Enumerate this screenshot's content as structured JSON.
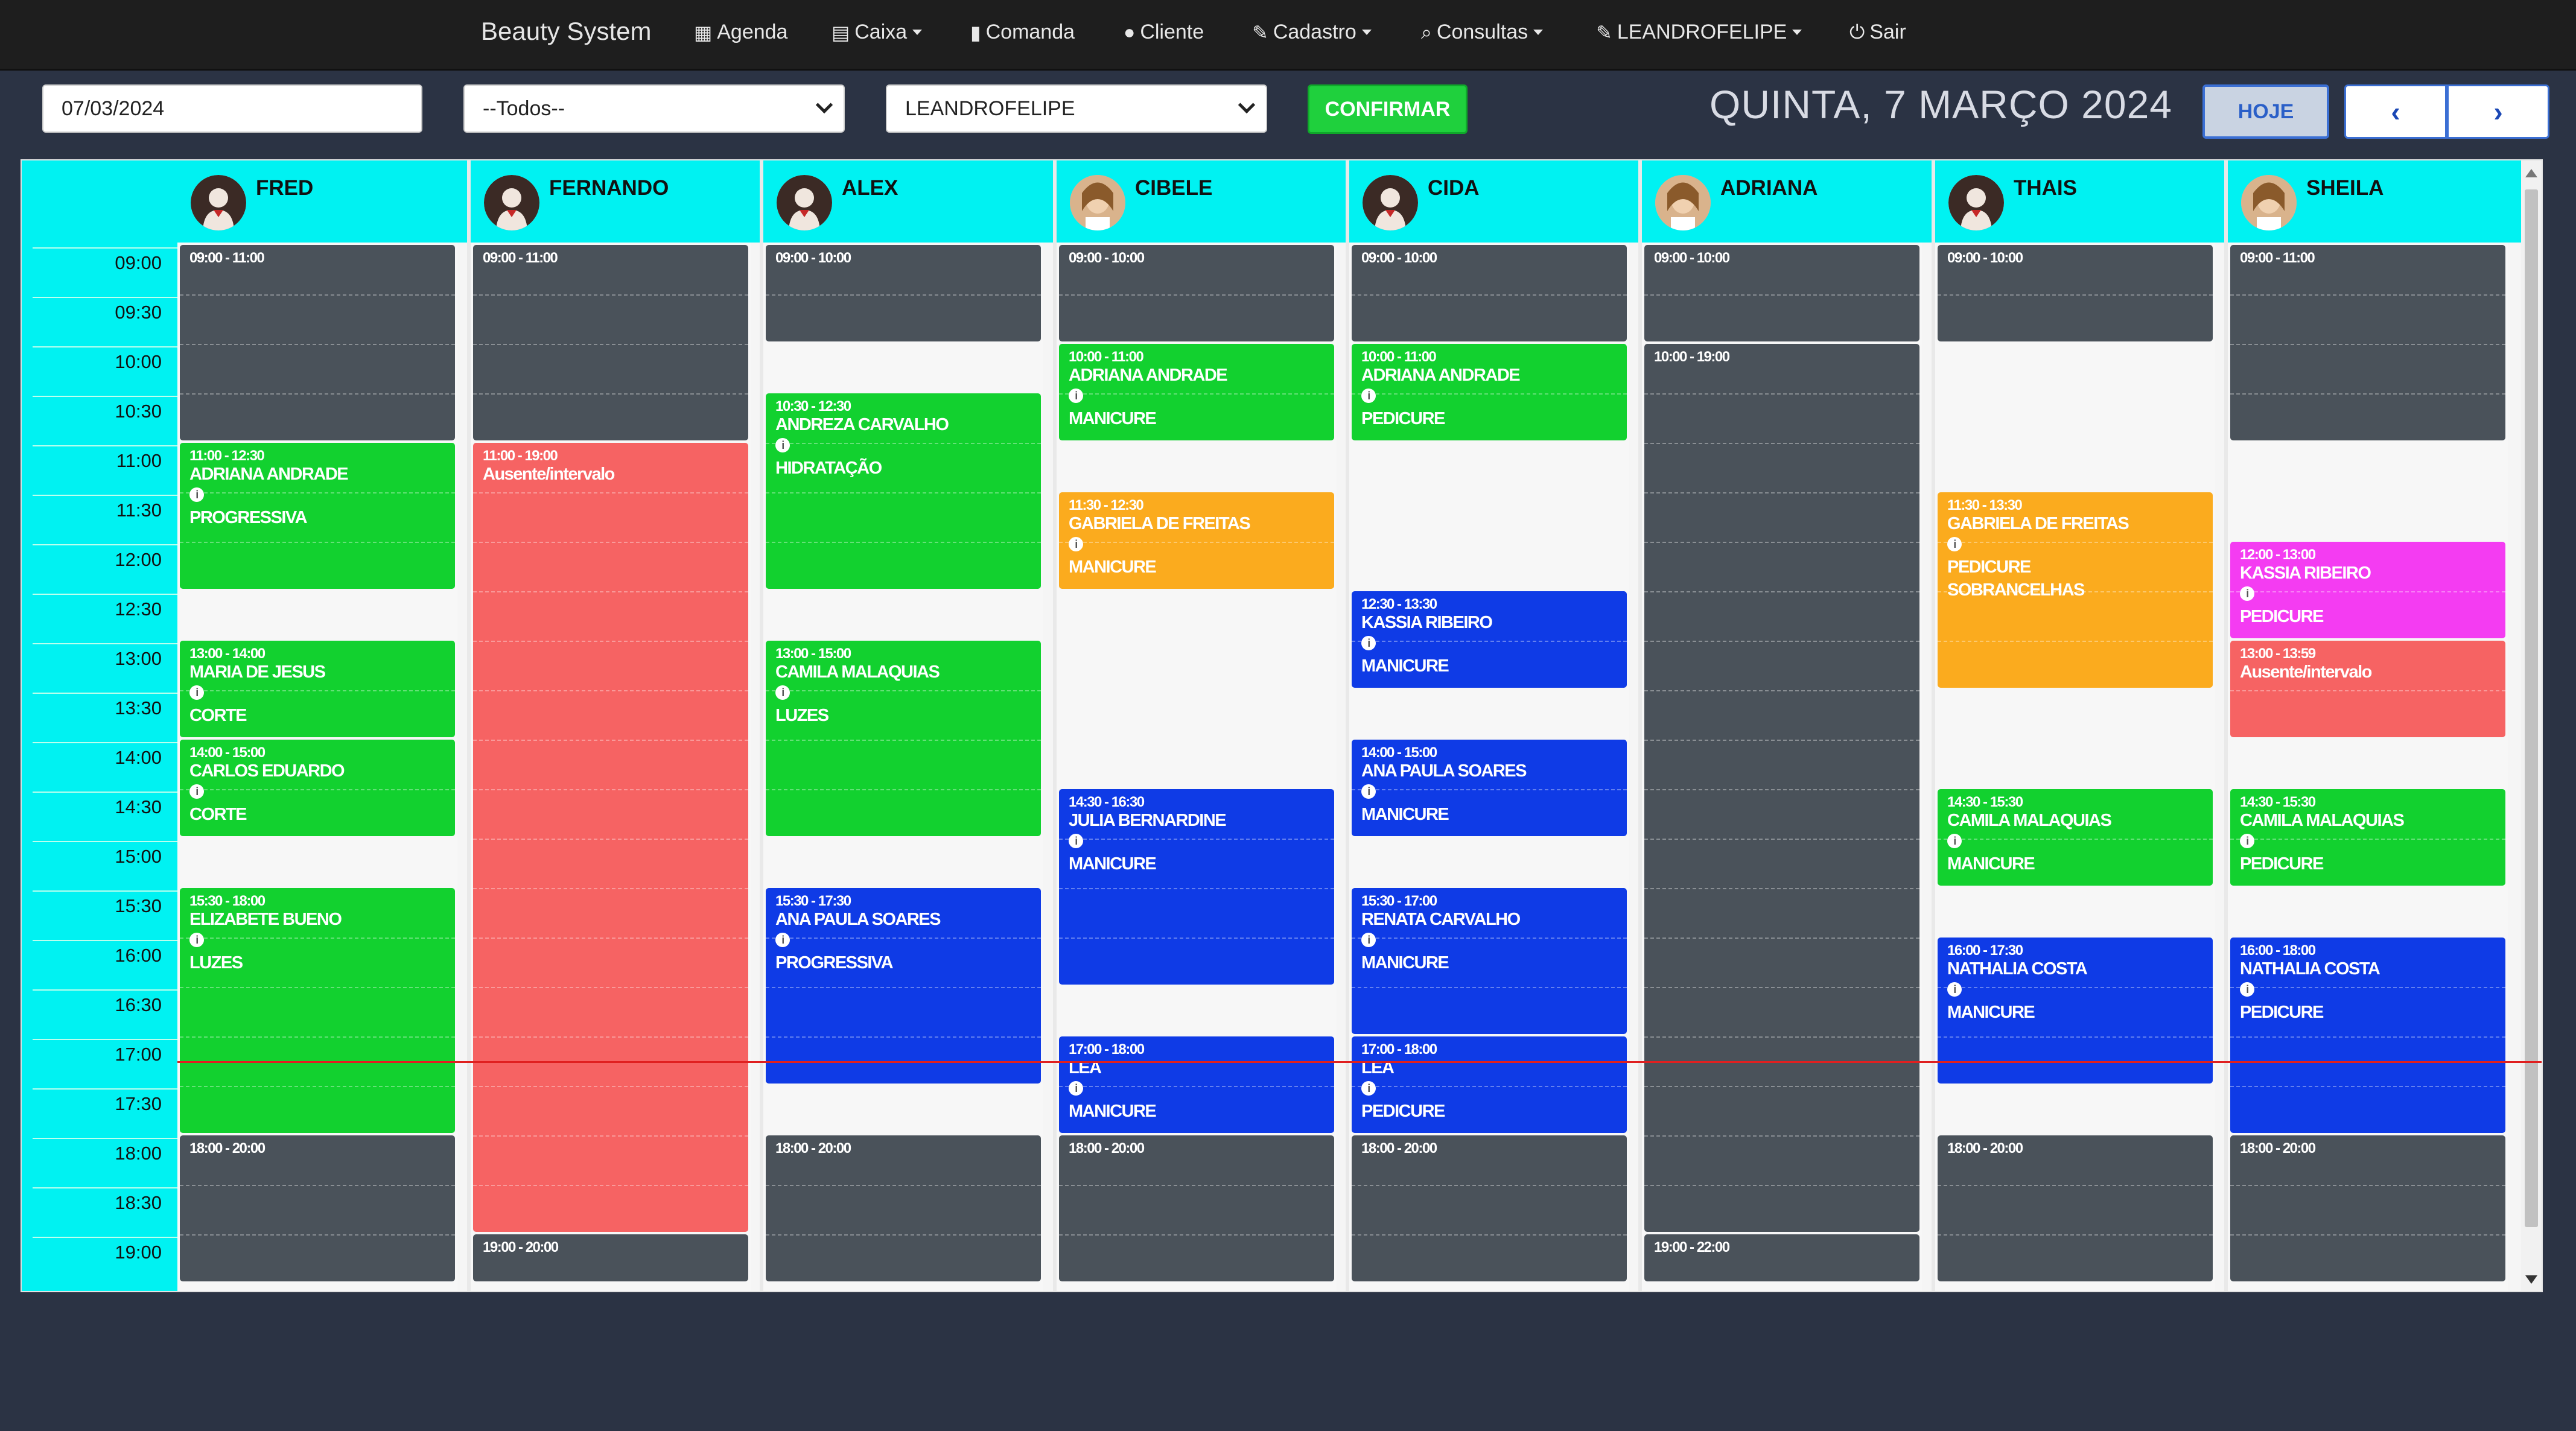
{
  "nav": {
    "brand": "Beauty System",
    "items": [
      {
        "label": "Agenda",
        "icon": "calendar-icon",
        "caret": false
      },
      {
        "label": "Caixa",
        "icon": "cash-register-icon",
        "caret": true
      },
      {
        "label": "Comanda",
        "icon": "document-icon",
        "caret": false
      },
      {
        "label": "Cliente",
        "icon": "user-icon",
        "caret": false
      },
      {
        "label": "Cadastro",
        "icon": "pencil-icon",
        "caret": true
      },
      {
        "label": "Consultas",
        "icon": "search-icon",
        "caret": true
      },
      {
        "label": "LEANDROFELIPE",
        "icon": "wrench-icon",
        "caret": true
      },
      {
        "label": "Sair",
        "icon": "power-icon",
        "caret": false
      }
    ]
  },
  "toolbar": {
    "date_value": "07/03/2024",
    "filter_selected": "--Todos--",
    "user_selected": "LEANDROFELIPE",
    "confirm_label": "CONFIRMAR",
    "date_title": "QUINTA, 7 MARÇO 2024",
    "today_label": "HOJE",
    "prev_label": "‹",
    "next_label": "›"
  },
  "calendar": {
    "times": [
      "09:00",
      "09:30",
      "10:00",
      "10:30",
      "11:00",
      "11:30",
      "12:00",
      "12:30",
      "13:00",
      "13:30",
      "14:00",
      "14:30",
      "15:00",
      "15:30",
      "16:00",
      "16:30",
      "17:00",
      "17:30",
      "18:00",
      "18:30",
      "19:00"
    ],
    "professionals": [
      {
        "name": "FRED",
        "avatar": "avatar-placeholder-icon"
      },
      {
        "name": "FERNANDO",
        "avatar": "avatar-placeholder-icon"
      },
      {
        "name": "ALEX",
        "avatar": "avatar-placeholder-icon"
      },
      {
        "name": "CIBELE",
        "avatar": "avatar-photo"
      },
      {
        "name": "CIDA",
        "avatar": "avatar-placeholder-icon"
      },
      {
        "name": "ADRIANA",
        "avatar": "avatar-photo"
      },
      {
        "name": "THAIS",
        "avatar": "avatar-placeholder-icon"
      },
      {
        "name": "SHEILA",
        "avatar": "avatar-photo"
      }
    ],
    "appointments": [
      {
        "col": 0,
        "start": "09:00",
        "end": "11:00",
        "time": "09:00 - 11:00",
        "client": "",
        "service": "",
        "status": "unavailable",
        "color": "#4a525a"
      },
      {
        "col": 0,
        "start": "11:00",
        "end": "12:30",
        "time": "11:00 - 12:30",
        "client": "ADRIANA ANDRADE",
        "service": "PROGRESSIVA",
        "status": "booked",
        "color": "#12d12f"
      },
      {
        "col": 0,
        "start": "13:00",
        "end": "14:00",
        "time": "13:00 - 14:00",
        "client": "MARIA DE JESUS",
        "service": "CORTE",
        "status": "booked",
        "color": "#12d12f"
      },
      {
        "col": 0,
        "start": "14:00",
        "end": "15:00",
        "time": "14:00 - 15:00",
        "client": "CARLOS EDUARDO",
        "service": "CORTE",
        "status": "booked",
        "color": "#12d12f"
      },
      {
        "col": 0,
        "start": "15:30",
        "end": "18:00",
        "time": "15:30 - 18:00",
        "client": "ELIZABETE BUENO",
        "service": "LUZES",
        "status": "booked",
        "color": "#12d12f"
      },
      {
        "col": 0,
        "start": "18:00",
        "end": "20:00",
        "time": "18:00 - 20:00",
        "client": "",
        "service": "",
        "status": "unavailable",
        "color": "#4a525a"
      },
      {
        "col": 1,
        "start": "09:00",
        "end": "11:00",
        "time": "09:00 - 11:00",
        "client": "",
        "service": "",
        "status": "unavailable",
        "color": "#4a525a"
      },
      {
        "col": 1,
        "start": "11:00",
        "end": "19:00",
        "time": "11:00 - 19:00",
        "client": "Ausente/intervalo",
        "service": "",
        "status": "absent",
        "color": "#f66363"
      },
      {
        "col": 1,
        "start": "19:00",
        "end": "20:00",
        "time": "19:00 - 20:00",
        "client": "",
        "service": "",
        "status": "unavailable",
        "color": "#4a525a"
      },
      {
        "col": 2,
        "start": "09:00",
        "end": "10:00",
        "time": "09:00 - 10:00",
        "client": "",
        "service": "",
        "status": "unavailable",
        "color": "#4a525a"
      },
      {
        "col": 2,
        "start": "10:30",
        "end": "12:30",
        "time": "10:30 - 12:30",
        "client": "ANDREZA CARVALHO",
        "service": "HIDRATAÇÃO",
        "status": "booked",
        "color": "#12d12f"
      },
      {
        "col": 2,
        "start": "13:00",
        "end": "15:00",
        "time": "13:00 - 15:00",
        "client": "CAMILA MALAQUIAS",
        "service": "LUZES",
        "status": "booked",
        "color": "#12d12f"
      },
      {
        "col": 2,
        "start": "15:30",
        "end": "17:30",
        "time": "15:30 - 17:30",
        "client": "ANA PAULA SOARES",
        "service": "PROGRESSIVA",
        "status": "booked",
        "color": "#0f3be6"
      },
      {
        "col": 2,
        "start": "18:00",
        "end": "20:00",
        "time": "18:00 - 20:00",
        "client": "",
        "service": "",
        "status": "unavailable",
        "color": "#4a525a"
      },
      {
        "col": 3,
        "start": "09:00",
        "end": "10:00",
        "time": "09:00 - 10:00",
        "client": "",
        "service": "",
        "status": "unavailable",
        "color": "#4a525a"
      },
      {
        "col": 3,
        "start": "10:00",
        "end": "11:00",
        "time": "10:00 - 11:00",
        "client": "ADRIANA ANDRADE",
        "service": "MANICURE",
        "status": "booked",
        "color": "#12d12f"
      },
      {
        "col": 3,
        "start": "11:30",
        "end": "12:30",
        "time": "11:30 - 12:30",
        "client": "GABRIELA DE FREITAS",
        "service": "MANICURE",
        "status": "booked",
        "color": "#fbab1e"
      },
      {
        "col": 3,
        "start": "14:30",
        "end": "16:30",
        "time": "14:30 - 16:30",
        "client": "JULIA BERNARDINE",
        "service": "MANICURE",
        "status": "booked",
        "color": "#0f3be6"
      },
      {
        "col": 3,
        "start": "17:00",
        "end": "18:00",
        "time": "17:00 - 18:00",
        "client": "LEA",
        "service": "MANICURE",
        "status": "booked",
        "color": "#0f3be6"
      },
      {
        "col": 3,
        "start": "18:00",
        "end": "20:00",
        "time": "18:00 - 20:00",
        "client": "",
        "service": "",
        "status": "unavailable",
        "color": "#4a525a"
      },
      {
        "col": 4,
        "start": "09:00",
        "end": "10:00",
        "time": "09:00 - 10:00",
        "client": "",
        "service": "",
        "status": "unavailable",
        "color": "#4a525a"
      },
      {
        "col": 4,
        "start": "10:00",
        "end": "11:00",
        "time": "10:00 - 11:00",
        "client": "ADRIANA ANDRADE",
        "service": "PEDICURE",
        "status": "booked",
        "color": "#12d12f"
      },
      {
        "col": 4,
        "start": "12:30",
        "end": "13:30",
        "time": "12:30 - 13:30",
        "client": "KASSIA RIBEIRO",
        "service": "MANICURE",
        "status": "booked",
        "color": "#0f3be6"
      },
      {
        "col": 4,
        "start": "14:00",
        "end": "15:00",
        "time": "14:00 - 15:00",
        "client": "ANA PAULA SOARES",
        "service": "MANICURE",
        "status": "booked",
        "color": "#0f3be6"
      },
      {
        "col": 4,
        "start": "15:30",
        "end": "17:00",
        "time": "15:30 - 17:00",
        "client": "RENATA CARVALHO",
        "service": "MANICURE",
        "status": "booked",
        "color": "#0f3be6"
      },
      {
        "col": 4,
        "start": "17:00",
        "end": "18:00",
        "time": "17:00 - 18:00",
        "client": "LEA",
        "service": "PEDICURE",
        "status": "booked",
        "color": "#0f3be6"
      },
      {
        "col": 4,
        "start": "18:00",
        "end": "20:00",
        "time": "18:00 - 20:00",
        "client": "",
        "service": "",
        "status": "unavailable",
        "color": "#4a525a"
      },
      {
        "col": 5,
        "start": "09:00",
        "end": "10:00",
        "time": "09:00 - 10:00",
        "client": "",
        "service": "",
        "status": "unavailable",
        "color": "#4a525a"
      },
      {
        "col": 5,
        "start": "10:00",
        "end": "19:00",
        "time": "10:00 - 19:00",
        "client": "",
        "service": "",
        "status": "unavailable",
        "color": "#4a525a"
      },
      {
        "col": 5,
        "start": "19:00",
        "end": "20:00",
        "time": "19:00 - 22:00",
        "client": "",
        "service": "",
        "status": "unavailable",
        "color": "#4a525a"
      },
      {
        "col": 6,
        "start": "09:00",
        "end": "10:00",
        "time": "09:00 - 10:00",
        "client": "",
        "service": "",
        "status": "unavailable",
        "color": "#4a525a"
      },
      {
        "col": 6,
        "start": "11:30",
        "end": "13:30",
        "time": "11:30 - 13:30",
        "client": "GABRIELA DE FREITAS",
        "service": "PEDICURE",
        "extra": "SOBRANCELHAS",
        "status": "booked",
        "color": "#fbab1e"
      },
      {
        "col": 6,
        "start": "14:30",
        "end": "15:30",
        "time": "14:30 - 15:30",
        "client": "CAMILA MALAQUIAS",
        "service": "MANICURE",
        "status": "booked",
        "color": "#12d12f"
      },
      {
        "col": 6,
        "start": "16:00",
        "end": "17:30",
        "time": "16:00 - 17:30",
        "client": "NATHALIA COSTA",
        "service": "MANICURE",
        "status": "booked",
        "color": "#0f3be6"
      },
      {
        "col": 6,
        "start": "18:00",
        "end": "20:00",
        "time": "18:00 - 20:00",
        "client": "",
        "service": "",
        "status": "unavailable",
        "color": "#4a525a"
      },
      {
        "col": 7,
        "start": "09:00",
        "end": "11:00",
        "time": "09:00 - 11:00",
        "client": "",
        "service": "",
        "status": "unavailable",
        "color": "#4a525a"
      },
      {
        "col": 7,
        "start": "12:00",
        "end": "13:00",
        "time": "12:00 - 13:00",
        "client": "KASSIA RIBEIRO",
        "service": "PEDICURE",
        "status": "booked",
        "color": "#f43cf2"
      },
      {
        "col": 7,
        "start": "13:00",
        "end": "14:00",
        "time": "13:00 - 13:59",
        "client": "Ausente/intervalo",
        "service": "",
        "status": "absent",
        "color": "#f66363"
      },
      {
        "col": 7,
        "start": "14:30",
        "end": "15:30",
        "time": "14:30 - 15:30",
        "client": "CAMILA MALAQUIAS",
        "service": "PEDICURE",
        "status": "booked",
        "color": "#12d12f"
      },
      {
        "col": 7,
        "start": "16:00",
        "end": "18:00",
        "time": "16:00 - 18:00",
        "client": "NATHALIA COSTA",
        "service": "PEDICURE",
        "status": "booked",
        "color": "#0f3be6"
      },
      {
        "col": 7,
        "start": "18:00",
        "end": "20:00",
        "time": "18:00 - 20:00",
        "client": "",
        "service": "",
        "status": "unavailable",
        "color": "#4a525a"
      }
    ]
  }
}
